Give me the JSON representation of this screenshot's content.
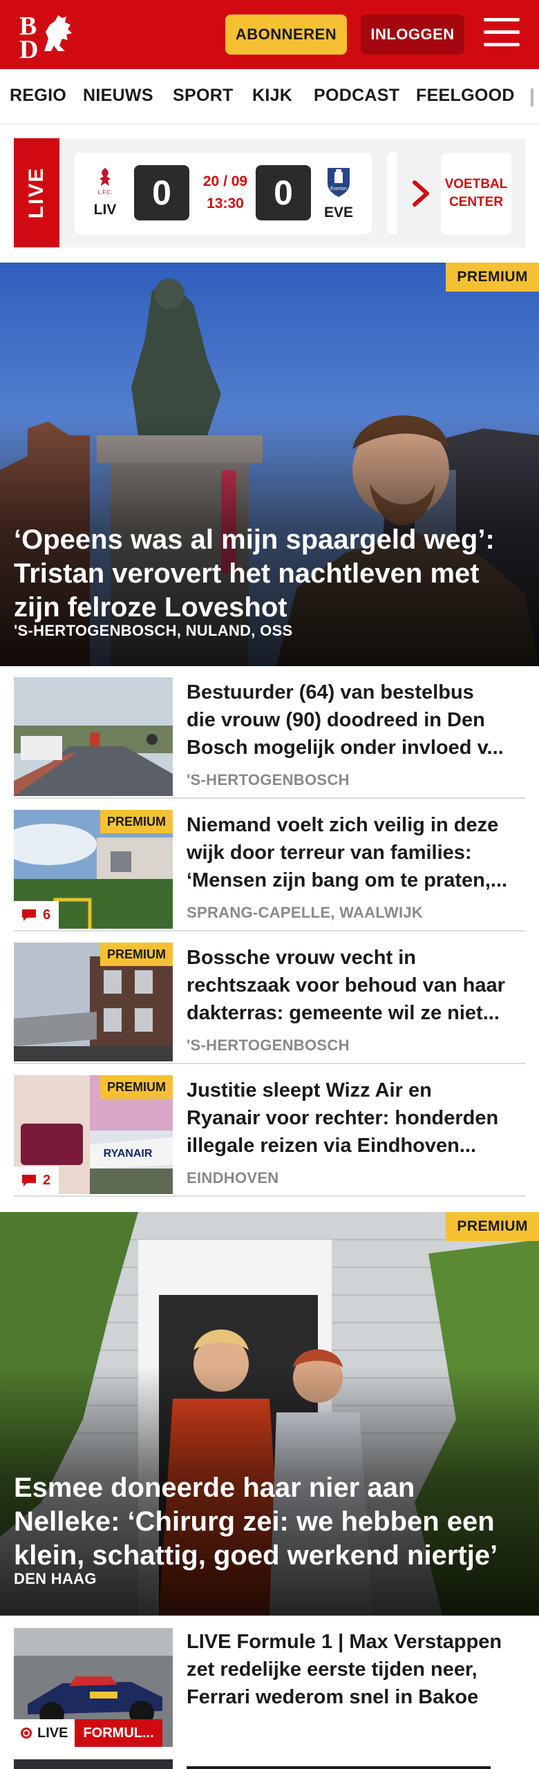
{
  "header": {
    "logo_text": "BD",
    "subscribe_label": "ABONNEREN",
    "login_label": "INLOGGEN",
    "brand_color": "#d10a11",
    "accent_color": "#f5c132"
  },
  "nav": {
    "items": [
      {
        "label": "REGIO"
      },
      {
        "label": "NIEUWS"
      },
      {
        "label": "SPORT"
      },
      {
        "label": "KIJK"
      },
      {
        "label": "PODCAST"
      },
      {
        "label": "FEELGOOD"
      }
    ]
  },
  "live_strip": {
    "tag": "LIVE",
    "home": {
      "code": "LIV",
      "score": "0"
    },
    "away": {
      "code": "EVE",
      "score": "0"
    },
    "date": "20 / 09",
    "time": "13:30",
    "voetbal_center": "VOETBAL CENTER"
  },
  "hero1": {
    "premium": "PREMIUM",
    "title": "‘Opeens was al mijn spaargeld weg’: Tristan verovert het nachtleven met zijn felroze Loveshot",
    "location": "'S-HERTOGENBOSCH, NULAND, OSS"
  },
  "articles": [
    {
      "title_lines": [
        "Bestuurder (64) van bestelbus",
        "die vrouw (90) doodreed in Den",
        "Bosch mogelijk onder invloed v..."
      ],
      "location": "'S-HERTOGENBOSCH"
    },
    {
      "premium": "PREMIUM",
      "comments": "6",
      "title_lines": [
        "Niemand voelt zich veilig in deze",
        "wijk door terreur van families:",
        "‘Mensen zijn bang om te praten,..."
      ],
      "location": "SPRANG-CAPELLE, WAALWIJK"
    },
    {
      "premium": "PREMIUM",
      "title_lines": [
        "Bossche vrouw vecht in",
        "rechtszaak voor behoud van haar",
        "dakterras: gemeente wil ze niet..."
      ],
      "location": "'S-HERTOGENBOSCH"
    },
    {
      "premium": "PREMIUM",
      "comments": "2",
      "title_lines": [
        "Justitie sleept Wizz Air en",
        "Ryanair voor rechter: honderden",
        "illegale reizen via Eindhoven..."
      ],
      "location": "EINDHOVEN"
    }
  ],
  "hero2": {
    "premium": "PREMIUM",
    "title": "Esmee doneerde haar nier aan Nelleke: ‘Chirurg zei: we hebben een klein, schattig, goed werkend niertje’",
    "location": "DEN HAAG"
  },
  "article_live": {
    "live_label": "LIVE",
    "category": "FORMUL...",
    "title_lines": [
      "LIVE Formule 1 | Max Verstappen",
      "zet redelijke eerste tijden neer,",
      "Ferrari wederom snel in Bakoe"
    ]
  }
}
